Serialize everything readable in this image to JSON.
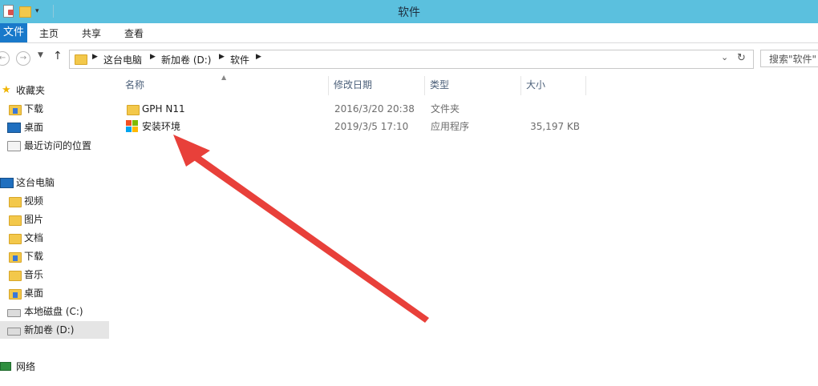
{
  "window": {
    "title": "软件"
  },
  "ribbon": {
    "file_tab": "文件",
    "tabs": [
      "主页",
      "共享",
      "查看"
    ]
  },
  "address": {
    "crumbs": [
      "这台电脑",
      "新加卷 (D:)",
      "软件"
    ],
    "search_placeholder": "搜索\"软件\""
  },
  "sidebar": {
    "favorites_label": "收藏夹",
    "favorites": [
      "下载",
      "桌面",
      "最近访问的位置"
    ],
    "this_pc_label": "这台电脑",
    "this_pc": [
      "视频",
      "图片",
      "文档",
      "下载",
      "音乐",
      "桌面",
      "本地磁盘 (C:)",
      "新加卷 (D:)"
    ],
    "network_label": "网络"
  },
  "columns": {
    "name": "名称",
    "modified": "修改日期",
    "type": "类型",
    "size": "大小"
  },
  "files": [
    {
      "name": "GPH N11",
      "modified": "2016/3/20 20:38",
      "type": "文件夹",
      "size": ""
    },
    {
      "name": "安装环境",
      "modified": "2019/3/5 17:10",
      "type": "应用程序",
      "size": "35,197 KB"
    }
  ],
  "colors": {
    "titlebar": "#5bc0de",
    "file_tab": "#1979ca",
    "annotation_arrow": "#e8403a"
  }
}
